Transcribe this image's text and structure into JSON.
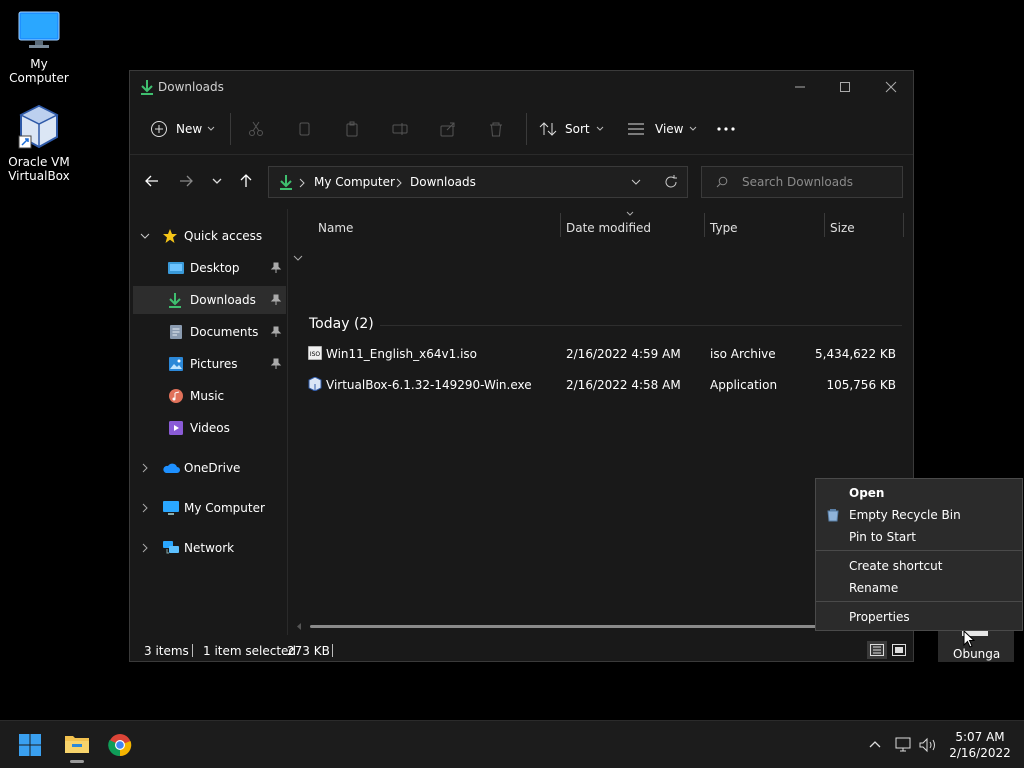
{
  "desktop": {
    "icons": [
      {
        "label": "My Computer"
      },
      {
        "label_line1": "Oracle VM",
        "label_line2": "VirtualBox"
      },
      {
        "label": "Obunga"
      }
    ]
  },
  "window": {
    "title": "Downloads",
    "toolbar": {
      "new_label": "New",
      "sort_label": "Sort",
      "view_label": "View"
    },
    "address": {
      "crumbs": [
        "My Computer",
        "Downloads"
      ]
    },
    "search": {
      "placeholder": "Search Downloads"
    },
    "nav": {
      "quick_access": "Quick access",
      "items": [
        {
          "label": "Desktop"
        },
        {
          "label": "Downloads"
        },
        {
          "label": "Documents"
        },
        {
          "label": "Pictures"
        },
        {
          "label": "Music"
        },
        {
          "label": "Videos"
        }
      ],
      "onedrive": "OneDrive",
      "my_computer": "My Computer",
      "network": "Network"
    },
    "columns": [
      "Name",
      "Date modified",
      "Type",
      "Size"
    ],
    "group_label": "Today (2)",
    "files": [
      {
        "name": "Win11_English_x64v1.iso",
        "date": "2/16/2022 4:59 AM",
        "type": "iso Archive",
        "size": "5,434,622 KB"
      },
      {
        "name": "VirtualBox-6.1.32-149290-Win.exe",
        "date": "2/16/2022 4:58 AM",
        "type": "Application",
        "size": "105,756 KB"
      }
    ],
    "status": {
      "items": "3 items",
      "selected": "1 item selected",
      "size": "273 KB"
    }
  },
  "context_menu": {
    "items": [
      "Open",
      "Empty Recycle Bin",
      "Pin to Start",
      "Create shortcut",
      "Rename",
      "Properties"
    ]
  },
  "taskbar": {
    "time": "5:07 AM",
    "date": "2/16/2022"
  },
  "colors": {
    "accent_green": "#3fbf6f",
    "star_yellow": "#f5c518",
    "folder_yellow": "#f2c14e"
  }
}
